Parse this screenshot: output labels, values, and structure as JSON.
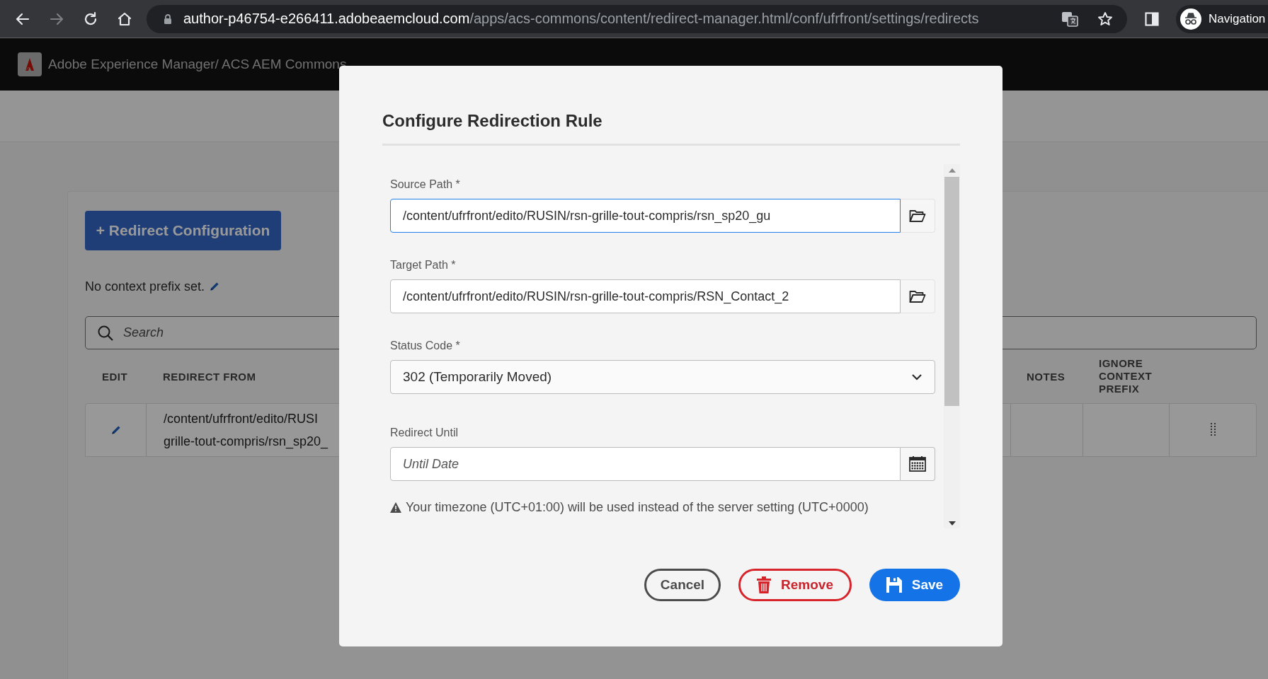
{
  "browser": {
    "address": {
      "host": "author-p46754-e266411.adobeaemcloud.com",
      "path": "/apps/acs-commons/content/redirect-manager.html/conf/ufrfront/settings/redirects"
    },
    "profile_label": "Navigation"
  },
  "app_header": {
    "breadcrumb": "Adobe Experience Manager/ ACS AEM Commons"
  },
  "page": {
    "add_button": "+ Redirect Configuration",
    "context_prefix_note": "No context prefix set.",
    "search": {
      "placeholder": "Search"
    },
    "table": {
      "columns": [
        {
          "label": "EDIT"
        },
        {
          "label": "REDIRECT FROM"
        },
        {
          "label": "NOTES"
        },
        {
          "label": "IGNORE CONTEXT PREFIX"
        }
      ],
      "rows": [
        {
          "redirect_from": [
            "/content/ufrfront/edito/RUSI",
            "grille-tout-compris/rsn_sp20_"
          ]
        }
      ]
    }
  },
  "dialog": {
    "title": "Configure Redirection Rule",
    "fields": [
      {
        "kind": "path",
        "label": "Source Path *",
        "value": "/content/ufrfront/edito/RUSIN/rsn-grille-tout-compris/rsn_sp20_gu",
        "focused": true
      },
      {
        "kind": "path",
        "label": "Target Path *",
        "value": "/content/ufrfront/edito/RUSIN/rsn-grille-tout-compris/RSN_Contact_2",
        "focused": false
      },
      {
        "kind": "select",
        "label": "Status Code *",
        "value": "302 (Temporarily Moved)"
      },
      {
        "kind": "date",
        "label": "Redirect Until",
        "placeholder": "Until Date"
      }
    ],
    "warning": "Your timezone (UTC+01:00) will be used instead of the server setting (UTC+0000)",
    "buttons": [
      {
        "kind": "cancel",
        "label": "Cancel"
      },
      {
        "kind": "remove",
        "label": "Remove"
      },
      {
        "kind": "save",
        "label": "Save"
      }
    ]
  }
}
